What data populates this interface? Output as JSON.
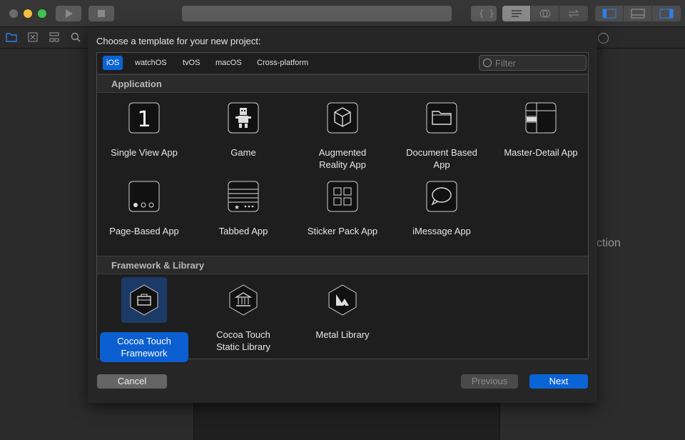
{
  "colors": {
    "accent": "#0b64d6",
    "selected_tile": "#1c3a66",
    "sheet_bg": "#262626"
  },
  "background": {
    "partial_text": "ction"
  },
  "sheet": {
    "title": "Choose a template for your new project:",
    "platform_tabs": [
      {
        "label": "iOS",
        "active": true
      },
      {
        "label": "watchOS",
        "active": false
      },
      {
        "label": "tvOS",
        "active": false
      },
      {
        "label": "macOS",
        "active": false
      },
      {
        "label": "Cross-platform",
        "active": false
      }
    ],
    "filter": {
      "placeholder": "Filter"
    },
    "sections": [
      {
        "title": "Application",
        "templates": [
          {
            "label": "Single View App",
            "icon": "single-view-icon"
          },
          {
            "label": "Game",
            "icon": "game-icon"
          },
          {
            "label": "Augmented\nReality App",
            "icon": "ar-cube-icon"
          },
          {
            "label": "Document Based\nApp",
            "icon": "folder-icon"
          },
          {
            "label": "Master-Detail App",
            "icon": "master-detail-icon"
          },
          {
            "label": "Page-Based App",
            "icon": "page-dots-icon"
          },
          {
            "label": "Tabbed App",
            "icon": "tab-bar-icon"
          },
          {
            "label": "Sticker Pack App",
            "icon": "sticker-grid-icon"
          },
          {
            "label": "iMessage App",
            "icon": "message-bubble-icon"
          }
        ]
      },
      {
        "title": "Framework & Library",
        "templates": [
          {
            "label": "Cocoa Touch\nFramework",
            "icon": "toolbox-icon",
            "selected": true
          },
          {
            "label": "Cocoa Touch\nStatic Library",
            "icon": "library-building-icon"
          },
          {
            "label": "Metal Library",
            "icon": "metal-icon"
          }
        ]
      }
    ],
    "buttons": {
      "cancel": "Cancel",
      "previous": "Previous",
      "next": "Next"
    }
  }
}
